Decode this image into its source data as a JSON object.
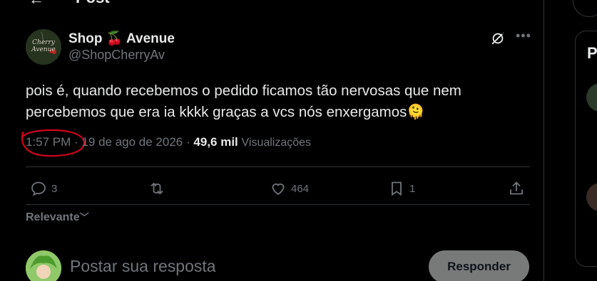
{
  "header": {
    "title": "Post"
  },
  "post": {
    "avatar_text_line1": "Cherry",
    "avatar_text_line2": "Avenue",
    "display_name": "Shop 🍒 Avenue",
    "handle": "@ShopCherryAv",
    "text": "pois é, quando recebemos o pedido ficamos tão nervosas que nem percebemos que era ia kkkk graças a vcs nós enxergamos🫠",
    "time": "1:57 PM",
    "separator": "·",
    "date": "19 de ago de 2026",
    "views_count": "49,6 mil",
    "views_label": "Visualizações"
  },
  "actions": {
    "replies": "3",
    "reposts": "",
    "likes": "464",
    "bookmarks": "1"
  },
  "sort": {
    "label": "Relevante"
  },
  "reply": {
    "placeholder": "Postar sua resposta",
    "button_label": "Responder"
  },
  "right_column": {
    "heading_partial": "P"
  },
  "colors": {
    "background": "#000000",
    "text_primary": "#e7e9ea",
    "text_secondary": "#71767b",
    "border": "#2f3336",
    "annotation_red": "#d0021b",
    "reply_button_bg": "#787a7a"
  }
}
